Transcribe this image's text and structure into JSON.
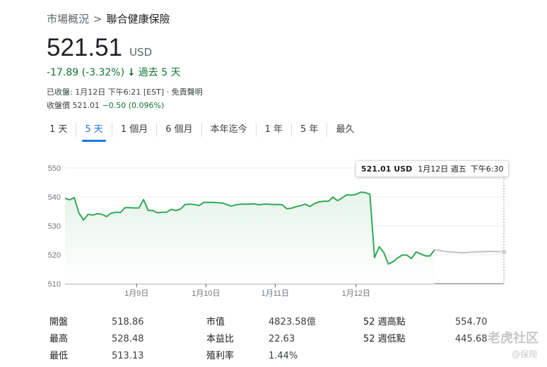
{
  "breadcrumb": {
    "parent": "市場概況",
    "separator": ">",
    "current": "聯合健康保險"
  },
  "quote": {
    "price": "521.51",
    "currency": "USD",
    "change": "-17.89 (-3.32%)",
    "period": "過去 5 天",
    "closed_text": "已收盤: 1月12日 下午6:21 [EST] · 免責聲明",
    "after_hours_label": "收盤價 521.01",
    "after_hours_change": "−0.50 (0.096%)"
  },
  "tabs": [
    {
      "label": "1 天"
    },
    {
      "label": "5 天",
      "active": true
    },
    {
      "label": "1 個月"
    },
    {
      "label": "6 個月"
    },
    {
      "label": "本年迄今"
    },
    {
      "label": "1 年"
    },
    {
      "label": "5 年"
    },
    {
      "label": "最久"
    }
  ],
  "tooltip": {
    "price": "521.01 USD",
    "date": "1月12日 週五",
    "time": "下午6:30"
  },
  "chart_data": {
    "type": "area",
    "ylim": [
      510,
      550
    ],
    "yticks": [
      "550",
      "540",
      "530",
      "520",
      "510"
    ],
    "xticks": [
      "1月9日",
      "1月10日",
      "1月11日",
      "1月12日"
    ],
    "x": [
      0,
      0.2,
      0.4,
      0.6,
      0.8,
      1.0,
      1.2,
      1.4,
      1.6,
      1.8,
      2.0,
      2.2,
      2.4,
      2.6,
      2.8,
      3.0,
      3.2,
      3.4,
      3.6,
      3.8,
      4.0,
      4.2,
      4.4,
      4.6,
      4.8,
      5.0,
      5.2,
      5.4,
      5.6,
      5.8,
      6.0,
      6.2,
      6.4,
      6.6,
      6.8,
      7.0,
      7.2,
      7.4,
      7.6,
      7.8,
      8.0,
      8.2,
      8.4,
      8.6,
      8.8,
      9.0,
      9.2,
      9.4,
      9.6,
      9.8,
      10.0,
      10.2,
      10.4,
      10.6,
      10.8,
      11.0,
      11.2,
      11.4,
      11.6,
      11.8,
      12.0,
      12.2,
      12.4,
      12.6,
      12.8,
      13.0,
      13.2,
      13.4,
      13.6,
      13.8,
      14.0,
      14.2,
      14.4,
      14.6,
      14.8,
      15.0,
      15.2,
      15.4,
      15.6,
      15.8,
      16.0,
      16.2,
      16.4,
      16.6,
      16.8,
      17.0,
      17.2,
      17.4,
      17.6,
      17.8,
      18.0,
      18.2,
      18.4,
      18.6,
      18.8,
      19.0
    ],
    "series": [
      {
        "values": [
          539.5,
          539,
          539.7,
          534.5,
          532,
          534,
          533.7,
          534.2,
          534,
          533.2,
          534.4,
          534.7,
          534.6,
          536.3,
          536.3,
          536.2,
          536.2,
          539.1,
          535.3,
          535.3,
          534.5,
          534.7,
          534.7,
          535.7,
          535.3,
          535.8,
          537.4,
          537.5,
          537.4,
          537,
          538.1,
          538.1,
          538.1,
          538,
          537.9,
          537.4,
          536.8,
          537.3,
          537.5,
          537.5,
          537.5,
          537.6,
          537.3,
          537.5,
          537.5,
          537.4,
          537.4,
          537.3,
          535.9,
          536.1,
          536.6,
          537,
          537.5,
          536.7,
          537.7,
          538.3,
          538.5,
          538.5,
          539.9,
          538.7,
          539.7,
          540.7,
          540.6,
          540.9,
          541.6,
          541.5,
          540.9,
          519,
          522.8,
          520.8,
          516.8,
          517.6,
          518.9,
          519.9,
          519.9,
          518.7,
          521,
          520.3,
          519.6,
          519.6,
          521.7
        ],
        "after_hours": [
          521.7,
          521,
          520.7,
          521,
          521.2,
          521.01
        ]
      }
    ]
  },
  "stats": [
    {
      "label": "開盤",
      "value": "518.86"
    },
    {
      "label": "最高",
      "value": "528.48"
    },
    {
      "label": "最低",
      "value": "513.13"
    },
    {
      "label": "市值",
      "value": "4823.58億"
    },
    {
      "label": "本益比",
      "value": "22.63"
    },
    {
      "label": "殖利率",
      "value": "1.44%"
    },
    {
      "label": "52 週高點",
      "value": "554.70"
    },
    {
      "label": "52 週低點",
      "value": "445.68"
    }
  ],
  "watermark": {
    "main": "老虎社区",
    "sub": "@保观"
  },
  "colors": {
    "line": "#34a853",
    "fill": "#e6f4ea",
    "after_hours": "#bdc1c6",
    "accent": "#1a73e8",
    "positive_text": "#137333"
  }
}
